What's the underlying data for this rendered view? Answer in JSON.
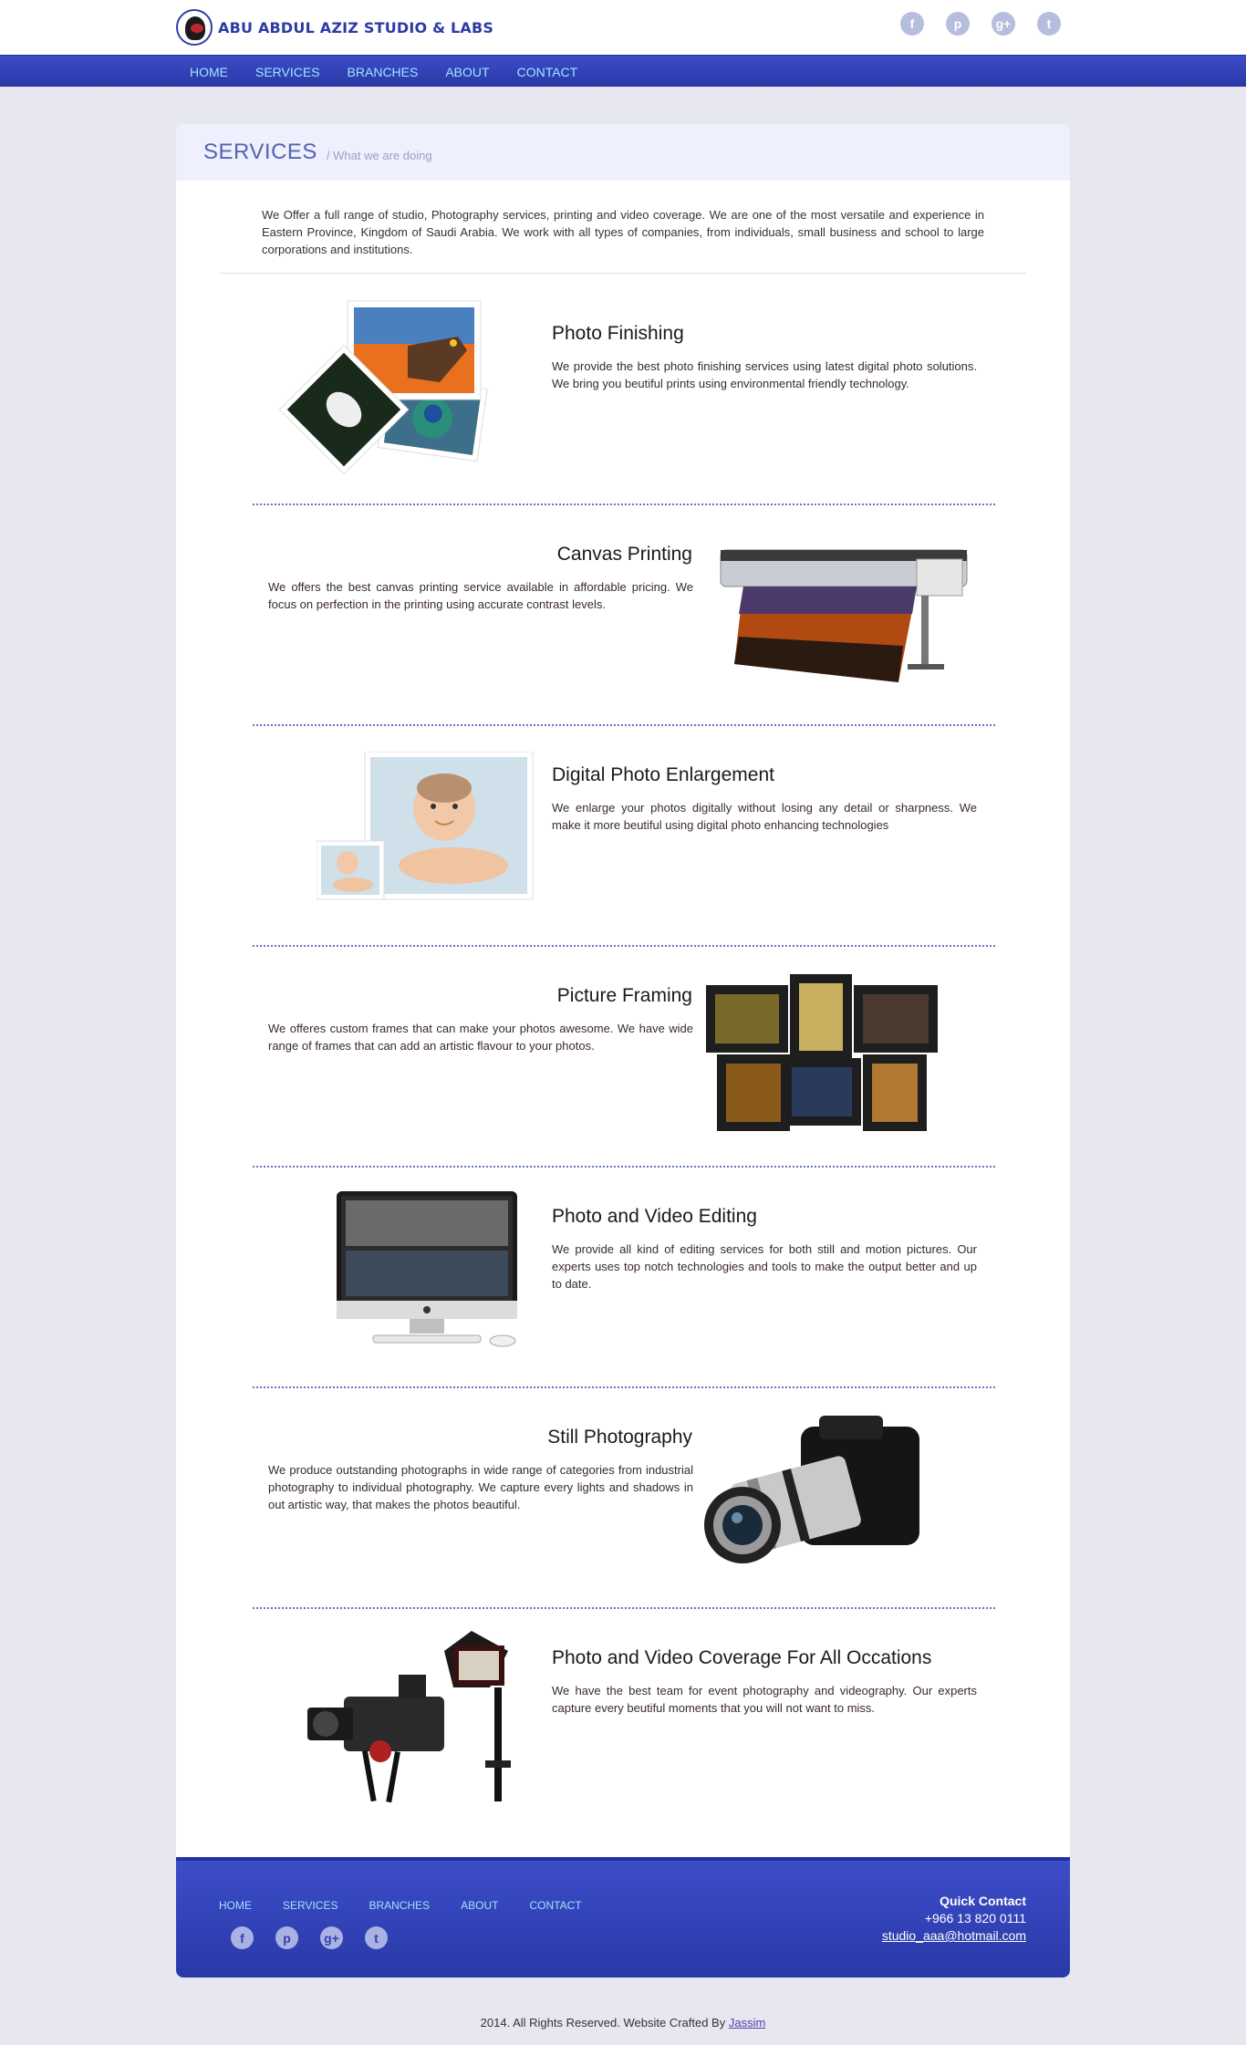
{
  "header": {
    "brand": "ABU ABDUL AZIZ STUDIO & LABS",
    "social": [
      {
        "icon": "facebook-icon",
        "glyph": "f"
      },
      {
        "icon": "pinterest-icon",
        "glyph": "p"
      },
      {
        "icon": "google-plus-icon",
        "glyph": "g+"
      },
      {
        "icon": "twitter-icon",
        "glyph": "t"
      }
    ]
  },
  "nav": [
    "HOME",
    "SERVICES",
    "BRANCHES",
    "ABOUT",
    "CONTACT"
  ],
  "page": {
    "title": "SERVICES",
    "subtitle": "/ What we are doing",
    "intro": "We Offer a full range of studio, Photography services, printing and video coverage. We are one of the most versatile and experience in Eastern Province, Kingdom of Saudi Arabia. We work with all types of companies, from individuals, small business and school to large corporations and institutions."
  },
  "services": [
    {
      "title": "Photo Finishing",
      "desc": "We provide the best photo finishing services using latest digital photo solutions. We bring you beutiful prints using environmental friendly technology.",
      "image": "photo-prints-image"
    },
    {
      "title": "Canvas Printing",
      "desc": "We offers the best canvas printing service available in affordable pricing. We focus on perfection in the printing using accurate contrast levels.",
      "image": "large-format-printer-image"
    },
    {
      "title": "Digital Photo Enlargement",
      "desc": "We enlarge your photos digitally without losing any detail or sharpness. We make it more beutiful using digital photo enhancing technologies",
      "image": "baby-photo-image"
    },
    {
      "title": "Picture Framing",
      "desc": "We offeres custom frames that can make your photos awesome. We have wide range of frames that can add an artistic flavour to your photos.",
      "image": "picture-frames-image"
    },
    {
      "title": "Photo and Video Editing",
      "desc": "We provide all kind of editing services for both still and motion pictures. Our experts uses top notch technologies and tools to make the output better and up to date.",
      "image": "imac-editing-image"
    },
    {
      "title": "Still Photography",
      "desc": "We produce outstanding photographs in wide range of categories from industrial photography to individual photography. We capture every lights and shadows in out artistic way, that makes the photos beautiful.",
      "image": "camera-image"
    },
    {
      "title": "Photo and Video Coverage For All Occations",
      "desc": "We have the best team for event photography and videography. Our experts capture every beutiful moments that you will not want to miss.",
      "image": "video-rig-image"
    }
  ],
  "footer": {
    "nav": [
      "HOME",
      "SERVICES",
      "BRANCHES",
      "ABOUT",
      "CONTACT"
    ],
    "quick_contact_title": "Quick Contact",
    "phone": "+966 13 820 0111",
    "email": "studio_aaa@hotmail.com"
  },
  "copyright": {
    "text": "2014. All Rights Reserved. Website Crafted By",
    "author": "Jassim"
  },
  "colors": {
    "nav_bar": "#2f3eb3",
    "nav_link": "#9fe4ff",
    "page_bg": "#e7e7f0",
    "title_blue": "#5463b3"
  }
}
